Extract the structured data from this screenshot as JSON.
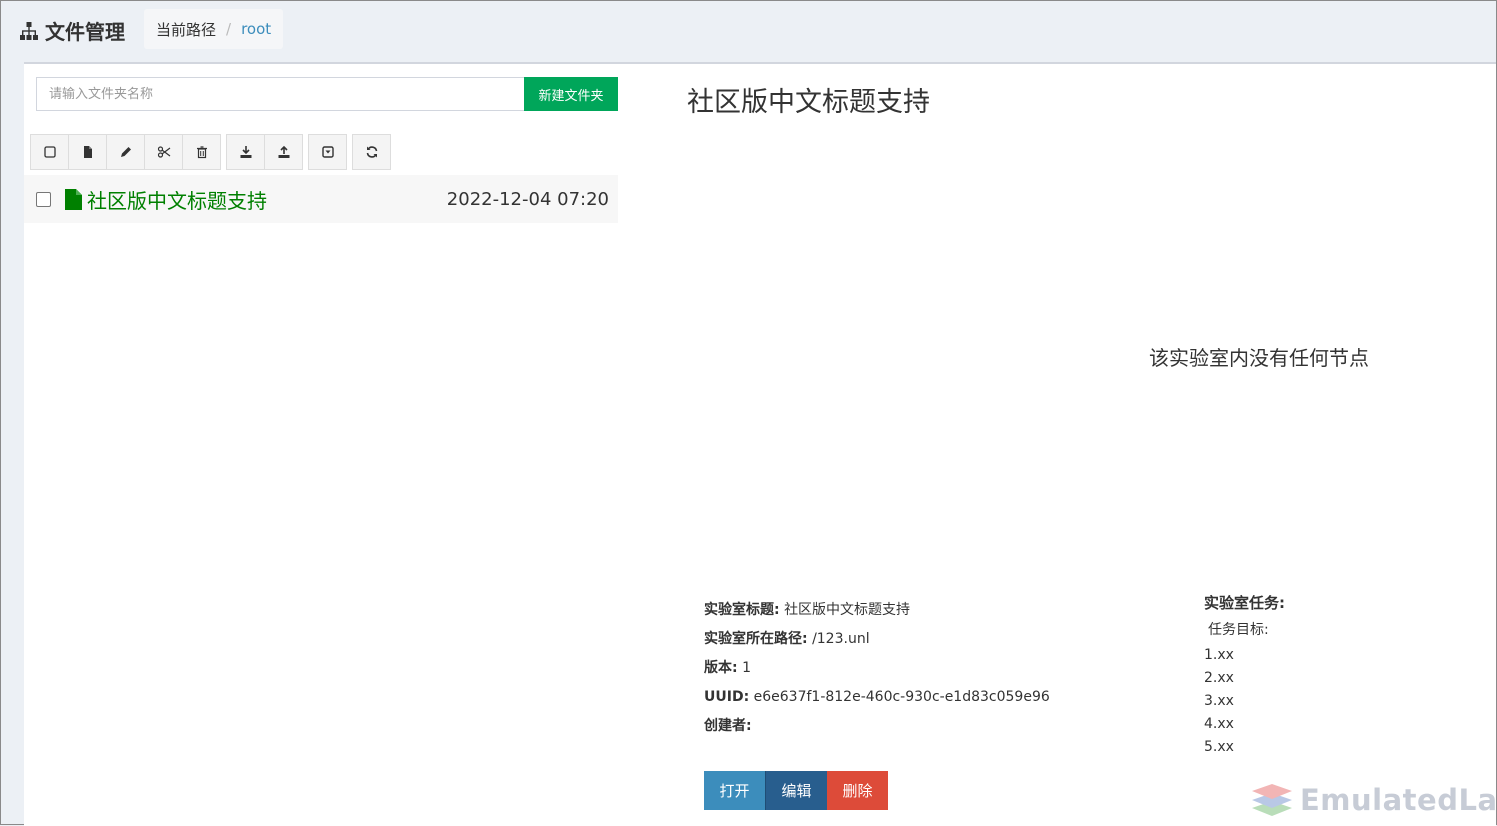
{
  "header": {
    "title": "文件管理",
    "breadcrumb_label": "当前路径",
    "breadcrumb_separator": "/",
    "breadcrumb_root": "root"
  },
  "folder": {
    "placeholder": "请输入文件夹名称",
    "value": "",
    "create_label": "新建文件夹"
  },
  "toolbar": {
    "icons": [
      "checkbox-icon",
      "file-icon",
      "pencil-icon",
      "scissors-icon",
      "trash-icon",
      "download-icon",
      "upload-icon",
      "archive-icon",
      "refresh-icon"
    ]
  },
  "files": [
    {
      "name": "社区版中文标题支持",
      "date": "2022-12-04 07:20"
    }
  ],
  "preview": {
    "title": "社区版中文标题支持",
    "empty_message": "该实验室内没有任何节点",
    "fields": [
      {
        "label": "实验室标题:",
        "value": "社区版中文标题支持"
      },
      {
        "label": "实验室所在路径:",
        "value": "/123.unl"
      },
      {
        "label": "版本:",
        "value": "1"
      },
      {
        "label": "UUID:",
        "value": "e6e637f1-812e-460c-930c-e1d83c059e96"
      },
      {
        "label": "创建者:",
        "value": ""
      }
    ],
    "tasks_heading": "实验室任务:",
    "tasks_subheading": "任务目标:",
    "tasks": [
      "1.xx",
      "2.xx",
      "3.xx",
      "4.xx",
      "5.xx"
    ],
    "buttons": {
      "open": "打开",
      "edit": "编辑",
      "delete": "删除"
    }
  },
  "watermark": {
    "text": "EmulatedLab"
  },
  "colors": {
    "accent_green": "#00a65a",
    "file_green": "#008000",
    "primary": "#3c8dbc",
    "primary_dark": "#285e8e",
    "danger": "#dd4b39"
  }
}
